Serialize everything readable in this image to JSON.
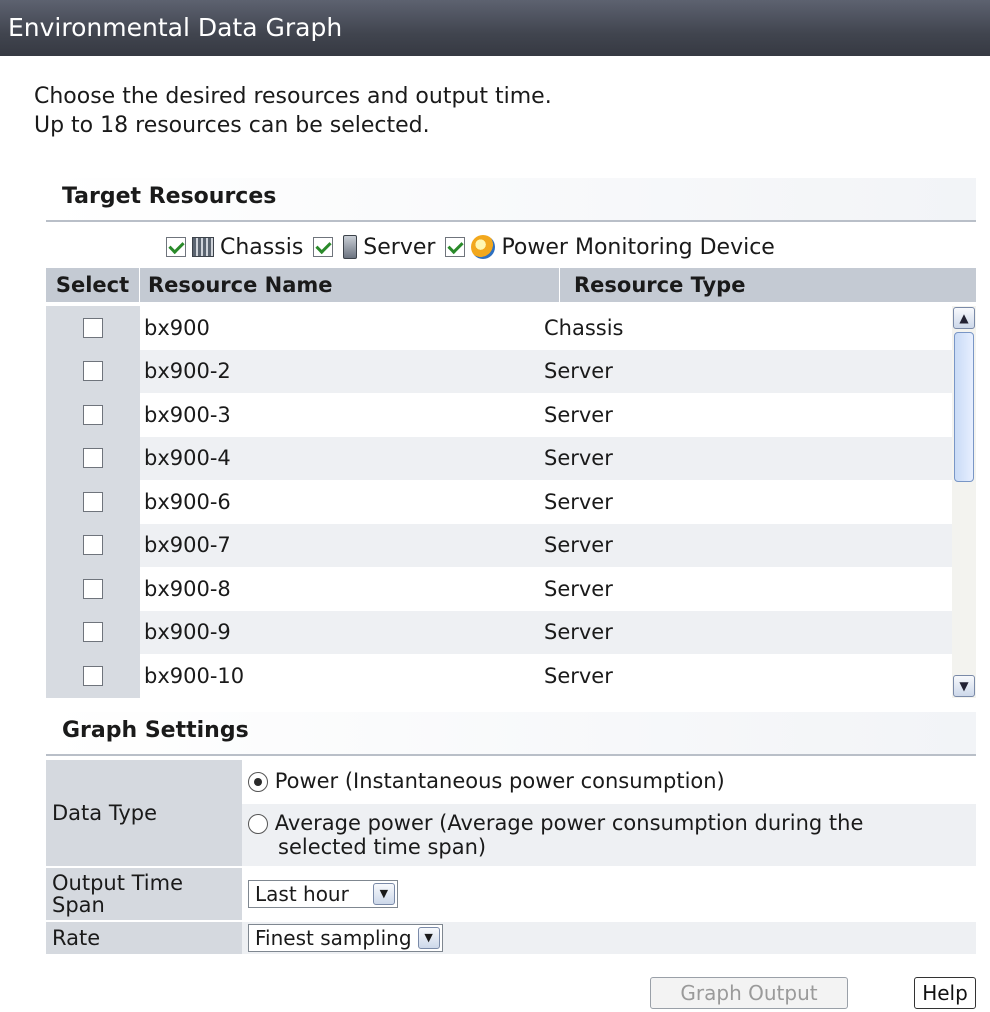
{
  "window": {
    "title": "Environmental Data Graph"
  },
  "intro": {
    "line1": "Choose the desired resources and output time.",
    "line2": "Up to 18 resources can be selected."
  },
  "target": {
    "heading": "Target Resources",
    "filters": [
      {
        "label": "Chassis",
        "checked": true,
        "icon": "chassis-icon"
      },
      {
        "label": "Server",
        "checked": true,
        "icon": "server-icon"
      },
      {
        "label": "Power Monitoring Device",
        "checked": true,
        "icon": "power-monitor-icon"
      }
    ],
    "columns": {
      "select": "Select",
      "name": "Resource Name",
      "type": "Resource Type"
    },
    "rows": [
      {
        "name": "bx900",
        "type": "Chassis",
        "checked": false
      },
      {
        "name": "bx900-2",
        "type": "Server",
        "checked": false
      },
      {
        "name": "bx900-3",
        "type": "Server",
        "checked": false
      },
      {
        "name": "bx900-4",
        "type": "Server",
        "checked": false
      },
      {
        "name": "bx900-6",
        "type": "Server",
        "checked": false
      },
      {
        "name": "bx900-7",
        "type": "Server",
        "checked": false
      },
      {
        "name": "bx900-8",
        "type": "Server",
        "checked": false
      },
      {
        "name": "bx900-9",
        "type": "Server",
        "checked": false
      },
      {
        "name": "bx900-10",
        "type": "Server",
        "checked": false
      }
    ]
  },
  "settings": {
    "heading": "Graph Settings",
    "data_type_label": "Data Type",
    "option_power": "Power (Instantaneous power consumption)",
    "option_avg_line1": "Average power (Average power consumption during the",
    "option_avg_line2": "selected time span)",
    "output_span_label_line1": "Output Time",
    "output_span_label_line2": "Span",
    "output_span_value": "Last hour",
    "rate_label": "Rate",
    "rate_value": "Finest sampling"
  },
  "buttons": {
    "graph_output": "Graph Output",
    "help": "Help"
  }
}
